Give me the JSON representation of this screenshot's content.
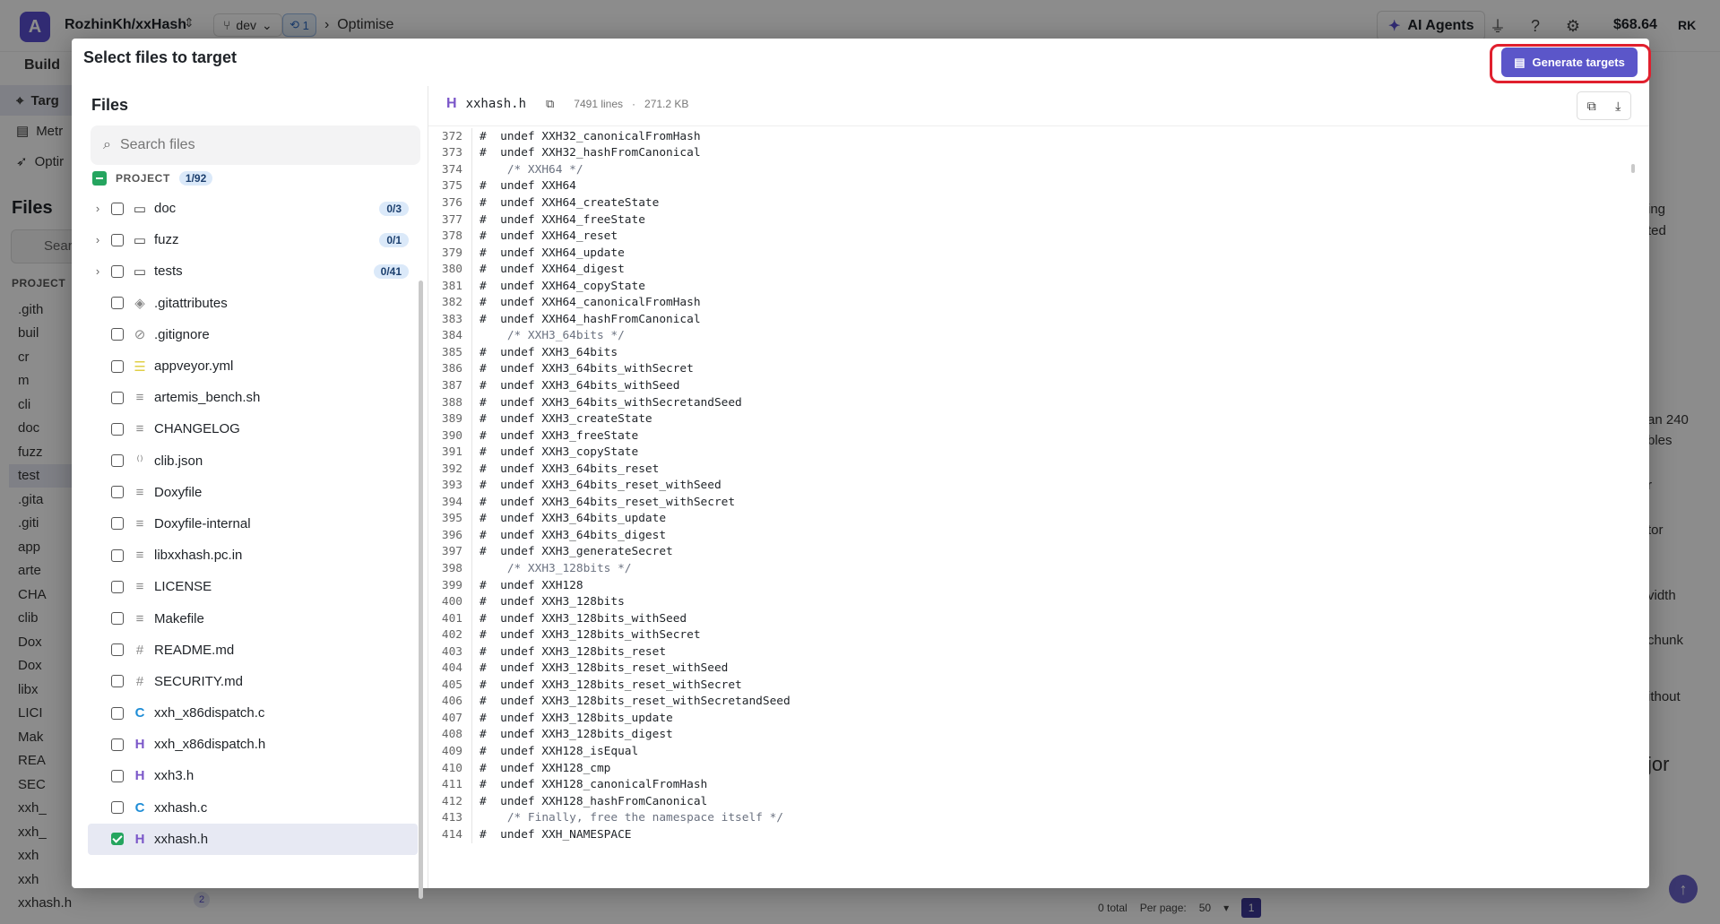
{
  "app": {
    "logo": "A",
    "repo": "RozhinKh/xxHash",
    "branch": "dev",
    "sync_count": "1",
    "breadcrumb": "Optimise",
    "ai_agents": "AI Agents",
    "balance": "$68.64",
    "user_initials": "RK",
    "build_tab": "Build",
    "nav": [
      "Targ",
      "Metr",
      "Optir"
    ],
    "files_title": "Files",
    "search_placeholder": "Sear",
    "project_label": "PROJECT",
    "bg_tree": [
      ".gith",
      "buil",
      "cr",
      "m",
      "cli",
      "doc",
      "fuzz",
      "test",
      ".gita",
      ".giti",
      "app",
      "arte",
      "CHA",
      "clib",
      "Dox",
      "Dox",
      "libx",
      "LICI",
      "Mak",
      "REA",
      "SEC",
      "xxh_",
      "xxh_",
      "xxh",
      "xxh",
      "xxhash.h"
    ],
    "bg_badge": "2",
    "pager": {
      "total": "0 total",
      "per_page_label": "Per page:",
      "per_page": "50",
      "page": "1"
    },
    "right_fragments": [
      "ing",
      "ted",
      "an 240",
      "bles",
      "r",
      "tor",
      "vidth",
      "chunk",
      "ithout",
      "jor"
    ]
  },
  "modal": {
    "title": "Select files to target",
    "generate_button": "Generate targets",
    "files_heading": "Files",
    "search_placeholder": "Search files",
    "project_label": "PROJECT",
    "project_count": "1/92",
    "tree": [
      {
        "name": "doc",
        "type": "folder",
        "count": "0/3"
      },
      {
        "name": "fuzz",
        "type": "folder",
        "count": "0/1"
      },
      {
        "name": "tests",
        "type": "folder",
        "count": "0/41"
      },
      {
        "name": ".gitattributes",
        "type": "git"
      },
      {
        "name": ".gitignore",
        "type": "ignore"
      },
      {
        "name": "appveyor.yml",
        "type": "yml"
      },
      {
        "name": "artemis_bench.sh",
        "type": "text"
      },
      {
        "name": "CHANGELOG",
        "type": "text"
      },
      {
        "name": "clib.json",
        "type": "json"
      },
      {
        "name": "Doxyfile",
        "type": "text"
      },
      {
        "name": "Doxyfile-internal",
        "type": "text"
      },
      {
        "name": "libxxhash.pc.in",
        "type": "text"
      },
      {
        "name": "LICENSE",
        "type": "text"
      },
      {
        "name": "Makefile",
        "type": "text"
      },
      {
        "name": "README.md",
        "type": "md"
      },
      {
        "name": "SECURITY.md",
        "type": "md"
      },
      {
        "name": "xxh_x86dispatch.c",
        "type": "c"
      },
      {
        "name": "xxh_x86dispatch.h",
        "type": "h"
      },
      {
        "name": "xxh3.h",
        "type": "h"
      },
      {
        "name": "xxhash.c",
        "type": "c"
      },
      {
        "name": "xxhash.h",
        "type": "h",
        "checked": true,
        "selected": true
      }
    ],
    "viewer": {
      "file": "xxhash.h",
      "lines_label": "7491 lines",
      "size_label": "271.2 KB",
      "code": [
        {
          "n": "372",
          "t": "#  undef XXH32_canonicalFromHash"
        },
        {
          "n": "373",
          "t": "#  undef XXH32_hashFromCanonical"
        },
        {
          "n": "374",
          "t": "    /* XXH64 */",
          "comment": true
        },
        {
          "n": "375",
          "t": "#  undef XXH64"
        },
        {
          "n": "376",
          "t": "#  undef XXH64_createState"
        },
        {
          "n": "377",
          "t": "#  undef XXH64_freeState"
        },
        {
          "n": "378",
          "t": "#  undef XXH64_reset"
        },
        {
          "n": "379",
          "t": "#  undef XXH64_update"
        },
        {
          "n": "380",
          "t": "#  undef XXH64_digest"
        },
        {
          "n": "381",
          "t": "#  undef XXH64_copyState"
        },
        {
          "n": "382",
          "t": "#  undef XXH64_canonicalFromHash"
        },
        {
          "n": "383",
          "t": "#  undef XXH64_hashFromCanonical"
        },
        {
          "n": "384",
          "t": "    /* XXH3_64bits */",
          "comment": true
        },
        {
          "n": "385",
          "t": "#  undef XXH3_64bits"
        },
        {
          "n": "386",
          "t": "#  undef XXH3_64bits_withSecret"
        },
        {
          "n": "387",
          "t": "#  undef XXH3_64bits_withSeed"
        },
        {
          "n": "388",
          "t": "#  undef XXH3_64bits_withSecretandSeed"
        },
        {
          "n": "389",
          "t": "#  undef XXH3_createState"
        },
        {
          "n": "390",
          "t": "#  undef XXH3_freeState"
        },
        {
          "n": "391",
          "t": "#  undef XXH3_copyState"
        },
        {
          "n": "392",
          "t": "#  undef XXH3_64bits_reset"
        },
        {
          "n": "393",
          "t": "#  undef XXH3_64bits_reset_withSeed"
        },
        {
          "n": "394",
          "t": "#  undef XXH3_64bits_reset_withSecret"
        },
        {
          "n": "395",
          "t": "#  undef XXH3_64bits_update"
        },
        {
          "n": "396",
          "t": "#  undef XXH3_64bits_digest"
        },
        {
          "n": "397",
          "t": "#  undef XXH3_generateSecret"
        },
        {
          "n": "398",
          "t": "    /* XXH3_128bits */",
          "comment": true
        },
        {
          "n": "399",
          "t": "#  undef XXH128"
        },
        {
          "n": "400",
          "t": "#  undef XXH3_128bits"
        },
        {
          "n": "401",
          "t": "#  undef XXH3_128bits_withSeed"
        },
        {
          "n": "402",
          "t": "#  undef XXH3_128bits_withSecret"
        },
        {
          "n": "403",
          "t": "#  undef XXH3_128bits_reset"
        },
        {
          "n": "404",
          "t": "#  undef XXH3_128bits_reset_withSeed"
        },
        {
          "n": "405",
          "t": "#  undef XXH3_128bits_reset_withSecret"
        },
        {
          "n": "406",
          "t": "#  undef XXH3_128bits_reset_withSecretandSeed"
        },
        {
          "n": "407",
          "t": "#  undef XXH3_128bits_update"
        },
        {
          "n": "408",
          "t": "#  undef XXH3_128bits_digest"
        },
        {
          "n": "409",
          "t": "#  undef XXH128_isEqual"
        },
        {
          "n": "410",
          "t": "#  undef XXH128_cmp"
        },
        {
          "n": "411",
          "t": "#  undef XXH128_canonicalFromHash"
        },
        {
          "n": "412",
          "t": "#  undef XXH128_hashFromCanonical"
        },
        {
          "n": "413",
          "t": "    /* Finally, free the namespace itself */",
          "comment": true
        },
        {
          "n": "414",
          "t": "#  undef XXH_NAMESPACE"
        }
      ]
    }
  }
}
